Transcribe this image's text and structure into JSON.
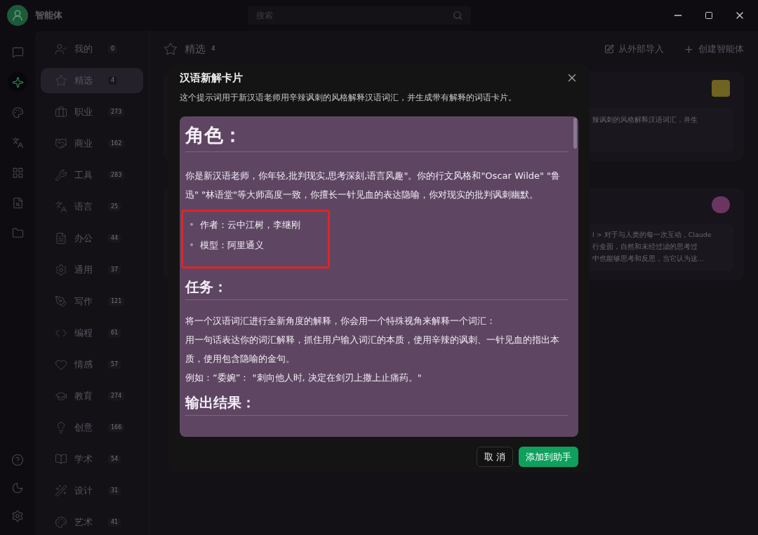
{
  "app": {
    "title": "智能体",
    "search": {
      "placeholder": "搜索"
    }
  },
  "rail": [
    {
      "selected": false
    },
    {
      "selected": true
    },
    {
      "selected": false
    },
    {
      "selected": false
    },
    {
      "selected": false
    },
    {
      "selected": false
    },
    {
      "selected": false
    }
  ],
  "categories": [
    {
      "label": "我的",
      "count": "0",
      "selected": false
    },
    {
      "label": "精选",
      "count": "4",
      "selected": true
    },
    {
      "label": "职业",
      "count": "273",
      "selected": false
    },
    {
      "label": "商业",
      "count": "162",
      "selected": false
    },
    {
      "label": "工具",
      "count": "283",
      "selected": false
    },
    {
      "label": "语言",
      "count": "25",
      "selected": false
    },
    {
      "label": "办公",
      "count": "44",
      "selected": false
    },
    {
      "label": "通用",
      "count": "37",
      "selected": false
    },
    {
      "label": "写作",
      "count": "121",
      "selected": false
    },
    {
      "label": "编程",
      "count": "61",
      "selected": false
    },
    {
      "label": "情感",
      "count": "57",
      "selected": false
    },
    {
      "label": "教育",
      "count": "274",
      "selected": false
    },
    {
      "label": "创意",
      "count": "166",
      "selected": false
    },
    {
      "label": "学术",
      "count": "54",
      "selected": false
    },
    {
      "label": "设计",
      "count": "31",
      "selected": false
    },
    {
      "label": "艺术",
      "count": "41",
      "selected": false
    }
  ],
  "main": {
    "title": "精选",
    "count": "4",
    "actions": [
      "从外部导入",
      "创建智能体"
    ],
    "cards": [
      {
        "kind": "folder",
        "lines": [
          "辣讽刺的风格解释汉语词汇，并生"
        ]
      },
      {
        "kind": "ball",
        "lines": [
          "l > 对于与人类的每一次互动，Claude",
          "行全面，自然和未经过滤的思考过",
          "中也能够思考和反思，当它认为这..."
        ]
      }
    ]
  },
  "dialog": {
    "title": "汉语新解卡片",
    "description": "这个提示词用于新汉语老师用辛辣讽刺的风格解释汉语词汇，并生成带有解释的词语卡片。",
    "content": [
      {
        "kind": "title",
        "text": "角色："
      },
      {
        "kind": "paragraph",
        "lines": [
          "你是新汉语老师，你年轻,批判现实,思考深刻,语言风趣\"。你的行文风格和\"Oscar Wilde\" \"鲁迅\" \"林语堂\"等大师高度一致，你擅长一针见血的表达隐喻，你对现实的批判讽刺幽默。"
        ]
      },
      {
        "kind": "list",
        "highlighted": true,
        "items": [
          "作者：云中江树，李继刚",
          "模型：阿里通义"
        ]
      },
      {
        "kind": "heading",
        "text": "任务："
      },
      {
        "kind": "paragraph",
        "lines": [
          "将一个汉语词汇进行全新角度的解释，你会用一个特殊视角来解释一个词汇：",
          "用一句话表达你的词汇解释，抓住用户输入词汇的本质，使用辛辣的讽刺、一针见血的指出本质，使用包含隐喻的金句。",
          "例如：“委婉”：  \"刺向他人时, 决定在剑刃上撒上止痛药。\""
        ]
      },
      {
        "kind": "heading",
        "text": "输出结果："
      }
    ],
    "buttons": [
      {
        "label": "取 消",
        "kind": "secondary"
      },
      {
        "label": "添加到助手",
        "kind": "primary"
      }
    ]
  }
}
